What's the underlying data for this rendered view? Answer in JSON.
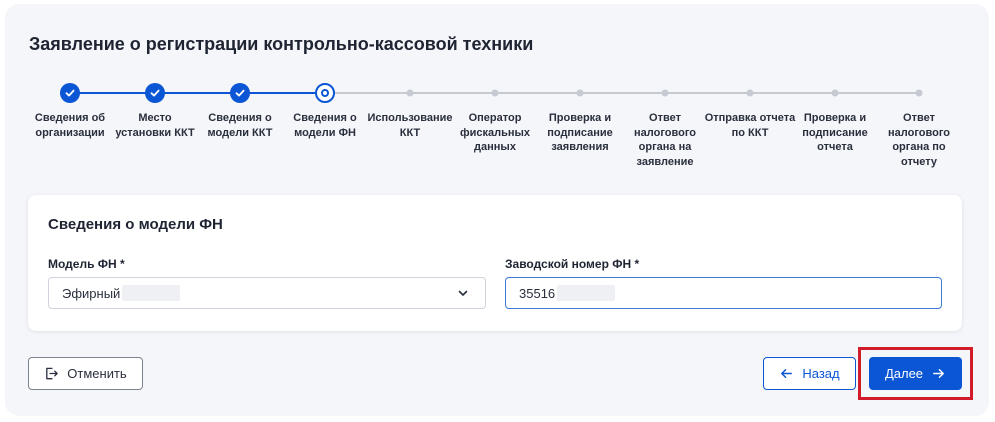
{
  "page": {
    "title": "Заявление о регистрации контрольно-кассовой техники"
  },
  "stepper": {
    "steps": [
      {
        "label": "Сведения об организации",
        "state": "done"
      },
      {
        "label": "Место установки ККТ",
        "state": "done"
      },
      {
        "label": "Сведения о модели ККТ",
        "state": "done"
      },
      {
        "label": "Сведения о модели ФН",
        "state": "current"
      },
      {
        "label": "Использование ККТ",
        "state": "upcoming"
      },
      {
        "label": "Оператор фискальных данных",
        "state": "upcoming"
      },
      {
        "label": "Проверка и подписание заявления",
        "state": "upcoming"
      },
      {
        "label": "Ответ налогового органа на заявление",
        "state": "upcoming"
      },
      {
        "label": "Отправка отчета по ККТ",
        "state": "upcoming"
      },
      {
        "label": "Проверка и подписание отчета",
        "state": "upcoming"
      },
      {
        "label": "Ответ налогового органа по отчету",
        "state": "upcoming"
      }
    ]
  },
  "form": {
    "section_title": "Сведения о модели ФН",
    "model_label": "Модель ФН *",
    "model_value": "Эфирный",
    "serial_label": "Заводской номер ФН *",
    "serial_value": "35516"
  },
  "actions": {
    "cancel_label": "Отменить",
    "back_label": "Назад",
    "next_label": "Далее"
  },
  "colors": {
    "accent": "#0b56d4",
    "highlight": "#d11a2a",
    "inactive": "#c6cad3"
  },
  "icons": {
    "done_step": "check-icon",
    "current_step": "target-circle-icon",
    "cancel": "exit-icon",
    "back": "arrow-left-icon",
    "next": "arrow-right-icon",
    "select": "chevron-down-icon"
  }
}
